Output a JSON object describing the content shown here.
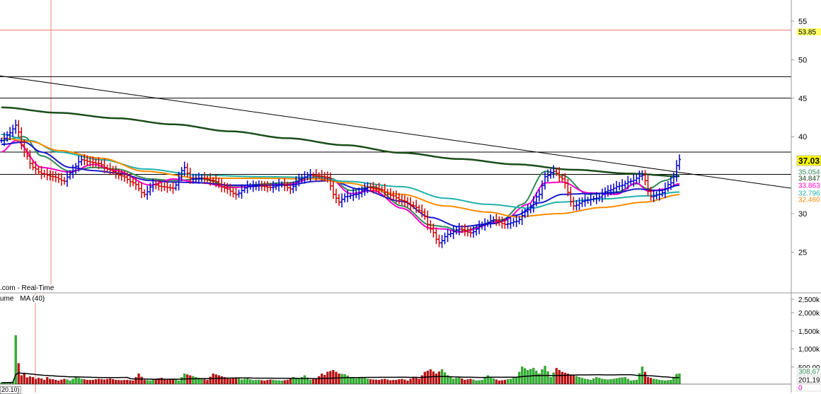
{
  "header": {
    "source_label": ".com - Real-Time",
    "volume_label": "ume",
    "volume_ma_label": "MA (40)",
    "date_label": "20.10)"
  },
  "price_axis": {
    "ticks": [
      "55",
      "50",
      "45",
      "40",
      "30",
      "25"
    ],
    "badges": [
      {
        "text": "53.85",
        "bg": "#ffff66",
        "fg": "#000000"
      },
      {
        "text": "37.03",
        "bg": "#ffff00",
        "fg": "#000000",
        "bold": true
      },
      {
        "text": "35.054",
        "bg": "#ffffff",
        "fg": "#2e8b57"
      },
      {
        "text": "34.847",
        "bg": "#ffffff",
        "fg": "#1a3a1a"
      },
      {
        "text": "33.863",
        "bg": "#ffffff",
        "fg": "#ff00cc"
      },
      {
        "text": "32.796",
        "bg": "#ffffff",
        "fg": "#20b2aa"
      },
      {
        "text": "32.460",
        "bg": "#ffffff",
        "fg": "#ff8c00"
      }
    ]
  },
  "volume_axis": {
    "ticks": [
      "2,500k",
      "2,000k",
      "1,500k",
      "1,000k",
      "500,00"
    ],
    "badges": [
      {
        "text": "308,67",
        "bg": "#ffffff",
        "fg": "#2e8b57"
      },
      {
        "text": "201,19",
        "bg": "#ffffff",
        "fg": "#000000"
      },
      {
        "text": "0",
        "bg": "#ffffff",
        "fg": "#cc00cc"
      }
    ]
  },
  "colors": {
    "up_bar": "#0000cc",
    "down_bar": "#cc0000",
    "vol_up": "#22bb22",
    "vol_down": "#cc0000",
    "vol_ma": "#000000",
    "ma_200": "#1a4d1a",
    "ma_green": "#2e8b57",
    "ma_magenta": "#ff00cc",
    "ma_blue": "#1a1acc",
    "ma_teal": "#20b2aa",
    "ma_orange": "#ff8c00",
    "crosshair": "#f08070",
    "levels": "#000000"
  },
  "chart_data": {
    "type": "line",
    "title": "",
    "price_range": [
      21,
      58
    ],
    "volume_range": [
      0,
      2700000
    ],
    "horizontal_levels": [
      57.8,
      53.85,
      47.8,
      45.0,
      38.0,
      35.1
    ],
    "crosshair_price": 53.85,
    "trendline": {
      "start": 47.9,
      "end": 33.3
    },
    "series": [
      {
        "name": "",
        "key": "ma200",
        "color_key": "ma_200",
        "anchors": [
          [
            0,
            43.8
          ],
          [
            20,
            43.1
          ],
          [
            40,
            42.4
          ],
          [
            60,
            41.6
          ],
          [
            80,
            40.7
          ],
          [
            100,
            39.8
          ],
          [
            120,
            38.9
          ],
          [
            140,
            37.9
          ],
          [
            160,
            37.1
          ],
          [
            180,
            36.4
          ],
          [
            200,
            35.7
          ],
          [
            220,
            35.2
          ],
          [
            237,
            34.85
          ]
        ]
      },
      {
        "name": "",
        "key": "ma_green",
        "color_key": "ma_green",
        "anchors": [
          [
            0,
            39.5
          ],
          [
            8,
            40.0
          ],
          [
            14,
            37.5
          ],
          [
            24,
            35.5
          ],
          [
            32,
            36.0
          ],
          [
            40,
            35.8
          ],
          [
            52,
            34.5
          ],
          [
            60,
            34.3
          ],
          [
            70,
            34.5
          ],
          [
            80,
            33.6
          ],
          [
            100,
            34.0
          ],
          [
            110,
            34.8
          ],
          [
            115,
            34.6
          ],
          [
            122,
            33.0
          ],
          [
            130,
            33.5
          ],
          [
            140,
            31.0
          ],
          [
            150,
            28.5
          ],
          [
            155,
            28.3
          ],
          [
            160,
            27.7
          ],
          [
            175,
            29.2
          ],
          [
            182,
            31.2
          ],
          [
            190,
            35.5
          ],
          [
            196,
            35.0
          ],
          [
            205,
            32.5
          ],
          [
            215,
            32.8
          ],
          [
            222,
            33.9
          ],
          [
            226,
            33.2
          ],
          [
            232,
            34.3
          ],
          [
            237,
            35.1
          ]
        ]
      },
      {
        "name": "",
        "key": "ma_magenta",
        "color_key": "ma_magenta",
        "anchors": [
          [
            0,
            38.0
          ],
          [
            5,
            39.5
          ],
          [
            14,
            36.0
          ],
          [
            24,
            35.4
          ],
          [
            32,
            36.4
          ],
          [
            40,
            35.6
          ],
          [
            52,
            33.7
          ],
          [
            60,
            34.5
          ],
          [
            70,
            34.0
          ],
          [
            80,
            33.4
          ],
          [
            100,
            33.8
          ],
          [
            110,
            34.7
          ],
          [
            115,
            34.5
          ],
          [
            122,
            32.6
          ],
          [
            130,
            33.0
          ],
          [
            140,
            30.7
          ],
          [
            150,
            28.1
          ],
          [
            155,
            28.0
          ],
          [
            160,
            27.6
          ],
          [
            175,
            29.0
          ],
          [
            184,
            31.2
          ],
          [
            190,
            34.0
          ],
          [
            196,
            34.1
          ],
          [
            205,
            32.7
          ],
          [
            215,
            32.5
          ],
          [
            222,
            34.0
          ],
          [
            226,
            32.9
          ],
          [
            232,
            33.2
          ],
          [
            237,
            33.9
          ]
        ]
      },
      {
        "name": "",
        "key": "ma_blue",
        "color_key": "ma_blue",
        "anchors": [
          [
            0,
            39.0
          ],
          [
            8,
            39.3
          ],
          [
            14,
            38.0
          ],
          [
            24,
            36.0
          ],
          [
            32,
            35.6
          ],
          [
            40,
            35.3
          ],
          [
            52,
            34.3
          ],
          [
            60,
            34.1
          ],
          [
            70,
            34.0
          ],
          [
            80,
            33.7
          ],
          [
            100,
            33.7
          ],
          [
            110,
            34.2
          ],
          [
            115,
            34.3
          ],
          [
            125,
            33.2
          ],
          [
            140,
            31.6
          ],
          [
            150,
            29.5
          ],
          [
            160,
            28.3
          ],
          [
            172,
            28.7
          ],
          [
            180,
            29.8
          ],
          [
            188,
            31.4
          ],
          [
            196,
            32.5
          ],
          [
            205,
            32.6
          ],
          [
            215,
            32.7
          ],
          [
            222,
            33.2
          ],
          [
            230,
            33.0
          ],
          [
            237,
            33.7
          ]
        ]
      },
      {
        "name": "",
        "key": "ma_teal",
        "color_key": "ma_teal",
        "anchors": [
          [
            0,
            40.3
          ],
          [
            10,
            39.5
          ],
          [
            20,
            38.0
          ],
          [
            35,
            37.0
          ],
          [
            50,
            35.8
          ],
          [
            70,
            35.0
          ],
          [
            90,
            34.8
          ],
          [
            110,
            34.7
          ],
          [
            120,
            34.2
          ],
          [
            140,
            33.5
          ],
          [
            155,
            32.0
          ],
          [
            170,
            31.2
          ],
          [
            185,
            30.7
          ],
          [
            195,
            31.5
          ],
          [
            210,
            31.9
          ],
          [
            225,
            32.3
          ],
          [
            237,
            32.8
          ]
        ]
      },
      {
        "name": "",
        "key": "ma_orange",
        "color_key": "ma_orange",
        "anchors": [
          [
            0,
            39.8
          ],
          [
            10,
            39.4
          ],
          [
            20,
            38.2
          ],
          [
            35,
            37.2
          ],
          [
            50,
            35.5
          ],
          [
            70,
            34.6
          ],
          [
            90,
            34.6
          ],
          [
            110,
            34.5
          ],
          [
            120,
            34.0
          ],
          [
            140,
            32.5
          ],
          [
            155,
            31.0
          ],
          [
            170,
            30.2
          ],
          [
            180,
            29.6
          ],
          [
            195,
            30.0
          ],
          [
            210,
            30.8
          ],
          [
            225,
            31.5
          ],
          [
            237,
            32.46
          ]
        ]
      }
    ],
    "price_path": [
      [
        0,
        39.5
      ],
      [
        3,
        40.5
      ],
      [
        5,
        41.5
      ],
      [
        8,
        38.0
      ],
      [
        11,
        36.0
      ],
      [
        14,
        35.2
      ],
      [
        18,
        34.8
      ],
      [
        22,
        34.2
      ],
      [
        24,
        35.3
      ],
      [
        28,
        37.0
      ],
      [
        31,
        36.7
      ],
      [
        34,
        36.5
      ],
      [
        37,
        35.8
      ],
      [
        42,
        34.9
      ],
      [
        46,
        34.0
      ],
      [
        50,
        32.5
      ],
      [
        53,
        33.8
      ],
      [
        56,
        33.5
      ],
      [
        60,
        33.3
      ],
      [
        64,
        36.0
      ],
      [
        66,
        34.5
      ],
      [
        70,
        34.6
      ],
      [
        74,
        34.3
      ],
      [
        78,
        33.3
      ],
      [
        82,
        32.5
      ],
      [
        86,
        33.5
      ],
      [
        90,
        33.6
      ],
      [
        94,
        33.4
      ],
      [
        98,
        33.8
      ],
      [
        101,
        33.2
      ],
      [
        104,
        34.5
      ],
      [
        108,
        35.0
      ],
      [
        111,
        34.9
      ],
      [
        114,
        34.7
      ],
      [
        116,
        32.5
      ],
      [
        118,
        31.5
      ],
      [
        120,
        32.2
      ],
      [
        124,
        32.5
      ],
      [
        128,
        33.4
      ],
      [
        132,
        33.2
      ],
      [
        136,
        32.4
      ],
      [
        140,
        31.7
      ],
      [
        144,
        31.0
      ],
      [
        147,
        30.2
      ],
      [
        150,
        28.0
      ],
      [
        153,
        26.2
      ],
      [
        156,
        27.3
      ],
      [
        160,
        28.0
      ],
      [
        164,
        27.5
      ],
      [
        168,
        28.5
      ],
      [
        172,
        29.2
      ],
      [
        176,
        28.6
      ],
      [
        180,
        29.0
      ],
      [
        184,
        30.5
      ],
      [
        188,
        32.5
      ],
      [
        190,
        34.8
      ],
      [
        193,
        35.5
      ],
      [
        196,
        34.5
      ],
      [
        200,
        31.0
      ],
      [
        204,
        31.7
      ],
      [
        208,
        32.0
      ],
      [
        212,
        33.0
      ],
      [
        216,
        33.6
      ],
      [
        220,
        34.2
      ],
      [
        224,
        35.0
      ],
      [
        227,
        32.2
      ],
      [
        230,
        32.5
      ],
      [
        234,
        34.0
      ],
      [
        237,
        37.03
      ]
    ],
    "volume": [
      [
        0,
        40000
      ],
      [
        2,
        50000
      ],
      [
        4,
        60000
      ],
      [
        5,
        1400000
      ],
      [
        6,
        600000
      ],
      [
        7,
        250000
      ],
      [
        8,
        300000
      ],
      [
        9,
        190000
      ],
      [
        10,
        220000
      ],
      [
        11,
        200000
      ],
      [
        12,
        150000
      ],
      [
        13,
        180000
      ],
      [
        14,
        160000
      ],
      [
        15,
        120000
      ],
      [
        16,
        200000
      ],
      [
        17,
        150000
      ],
      [
        18,
        140000
      ],
      [
        19,
        120000
      ],
      [
        20,
        100000
      ],
      [
        22,
        150000
      ],
      [
        23,
        130000
      ],
      [
        24,
        100000
      ],
      [
        26,
        200000
      ],
      [
        28,
        150000
      ],
      [
        30,
        120000
      ],
      [
        32,
        120000
      ],
      [
        34,
        150000
      ],
      [
        36,
        130000
      ],
      [
        38,
        160000
      ],
      [
        40,
        120000
      ],
      [
        42,
        110000
      ],
      [
        44,
        120000
      ],
      [
        46,
        100000
      ],
      [
        48,
        300000
      ],
      [
        50,
        120000
      ],
      [
        52,
        100000
      ],
      [
        54,
        150000
      ],
      [
        56,
        180000
      ],
      [
        58,
        120000
      ],
      [
        60,
        150000
      ],
      [
        62,
        100000
      ],
      [
        64,
        300000
      ],
      [
        66,
        250000
      ],
      [
        68,
        200000
      ],
      [
        70,
        150000
      ],
      [
        72,
        120000
      ],
      [
        74,
        300000
      ],
      [
        76,
        250000
      ],
      [
        78,
        200000
      ],
      [
        80,
        150000
      ],
      [
        82,
        180000
      ],
      [
        84,
        130000
      ],
      [
        86,
        160000
      ],
      [
        88,
        110000
      ],
      [
        90,
        120000
      ],
      [
        92,
        100000
      ],
      [
        94,
        130000
      ],
      [
        96,
        110000
      ],
      [
        98,
        100000
      ],
      [
        100,
        120000
      ],
      [
        102,
        200000
      ],
      [
        104,
        150000
      ],
      [
        106,
        250000
      ],
      [
        108,
        120000
      ],
      [
        110,
        150000
      ],
      [
        112,
        300000
      ],
      [
        113,
        260000
      ],
      [
        114,
        350000
      ],
      [
        116,
        400000
      ],
      [
        118,
        300000
      ],
      [
        120,
        280000
      ],
      [
        122,
        200000
      ],
      [
        124,
        160000
      ],
      [
        126,
        200000
      ],
      [
        128,
        150000
      ],
      [
        130,
        130000
      ],
      [
        132,
        120000
      ],
      [
        134,
        150000
      ],
      [
        136,
        110000
      ],
      [
        138,
        120000
      ],
      [
        140,
        150000
      ],
      [
        142,
        100000
      ],
      [
        144,
        200000
      ],
      [
        146,
        150000
      ],
      [
        148,
        350000
      ],
      [
        150,
        420000
      ],
      [
        152,
        300000
      ],
      [
        154,
        420000
      ],
      [
        156,
        250000
      ],
      [
        158,
        150000
      ],
      [
        160,
        200000
      ],
      [
        162,
        120000
      ],
      [
        164,
        150000
      ],
      [
        166,
        100000
      ],
      [
        168,
        120000
      ],
      [
        170,
        250000
      ],
      [
        172,
        160000
      ],
      [
        174,
        100000
      ],
      [
        176,
        120000
      ],
      [
        178,
        150000
      ],
      [
        180,
        200000
      ],
      [
        182,
        500000
      ],
      [
        184,
        400000
      ],
      [
        186,
        460000
      ],
      [
        188,
        300000
      ],
      [
        189,
        420000
      ],
      [
        190,
        520000
      ],
      [
        192,
        200000
      ],
      [
        194,
        460000
      ],
      [
        196,
        350000
      ],
      [
        198,
        300000
      ],
      [
        200,
        250000
      ],
      [
        202,
        200000
      ],
      [
        204,
        150000
      ],
      [
        206,
        120000
      ],
      [
        208,
        200000
      ],
      [
        210,
        150000
      ],
      [
        212,
        130000
      ],
      [
        214,
        150000
      ],
      [
        216,
        180000
      ],
      [
        218,
        200000
      ],
      [
        220,
        100000
      ],
      [
        222,
        120000
      ],
      [
        224,
        500000
      ],
      [
        226,
        200000
      ],
      [
        228,
        150000
      ],
      [
        230,
        120000
      ],
      [
        232,
        100000
      ],
      [
        234,
        120000
      ],
      [
        236,
        290000
      ],
      [
        237,
        300000
      ]
    ]
  }
}
